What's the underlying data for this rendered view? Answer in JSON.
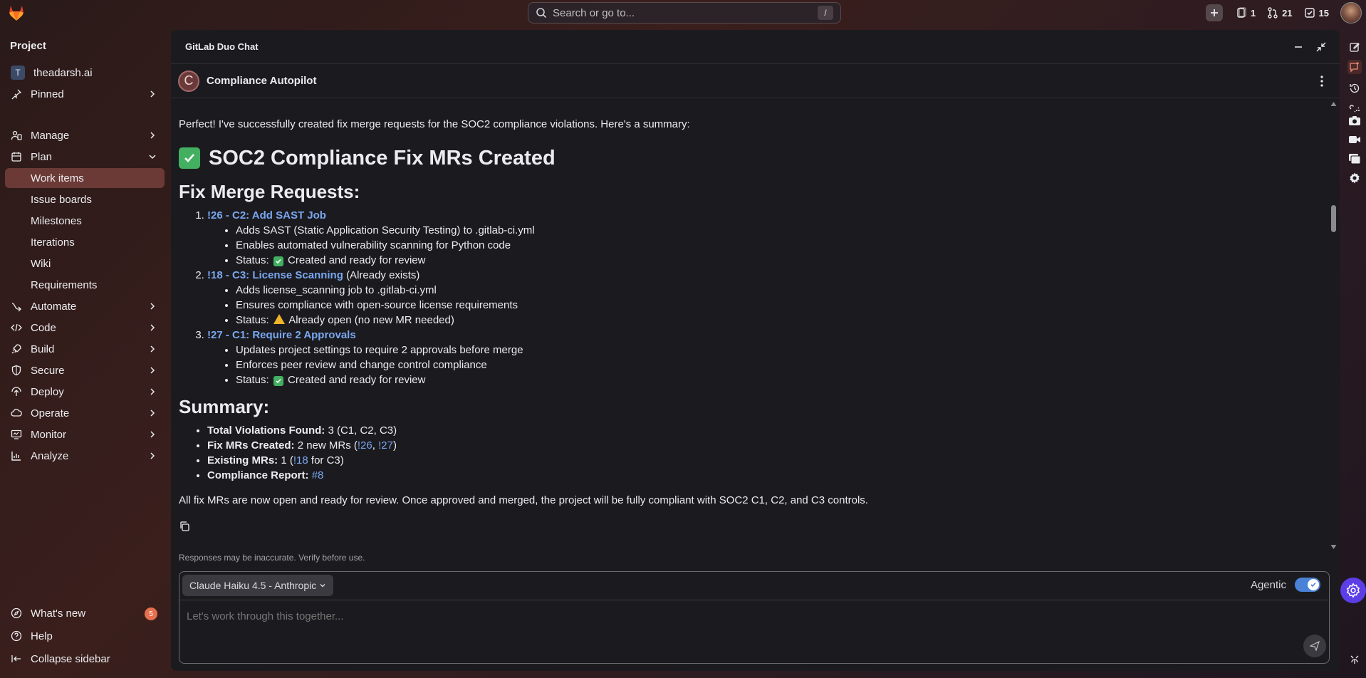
{
  "topbar": {
    "search_placeholder": "Search or go to...",
    "search_shortcut": "/",
    "issues_count": "1",
    "mrs_count": "21",
    "todos_count": "15"
  },
  "sidebar": {
    "title": "Project",
    "project_initial": "T",
    "project_name": "theadarsh.ai",
    "pinned": "Pinned",
    "manage": "Manage",
    "plan": "Plan",
    "plan_items": [
      "Work items",
      "Issue boards",
      "Milestones",
      "Iterations",
      "Wiki",
      "Requirements"
    ],
    "automate": "Automate",
    "code": "Code",
    "build": "Build",
    "secure": "Secure",
    "deploy": "Deploy",
    "operate": "Operate",
    "monitor": "Monitor",
    "analyze": "Analyze",
    "whats_new": "What's new",
    "whats_new_badge": "5",
    "help": "Help",
    "collapse": "Collapse sidebar"
  },
  "chat": {
    "title": "GitLab Duo Chat",
    "agent_initial": "C",
    "agent_name": "Compliance Autopilot",
    "intro": "Perfect! I've successfully created fix merge requests for the SOC2 compliance violations. Here's a summary:",
    "heading": "SOC2 Compliance Fix MRs Created",
    "fix_heading": "Fix Merge Requests:",
    "mrs": [
      {
        "link": "!26 - C2: Add SAST Job",
        "suffix": "",
        "details": [
          "Adds SAST (Static Application Security Testing) to .gitlab-ci.yml",
          "Enables automated vulnerability scanning for Python code"
        ],
        "status_label": "Status:",
        "status_text": "Created and ready for review"
      },
      {
        "link": "!18 - C3: License Scanning",
        "suffix": "(Already exists)",
        "details": [
          "Adds license_scanning job to .gitlab-ci.yml",
          "Ensures compliance with open-source license requirements"
        ],
        "status_label": "Status:",
        "status_text": "Already open (no new MR needed)"
      },
      {
        "link": "!27 - C1: Require 2 Approvals",
        "suffix": "",
        "details": [
          "Updates project settings to require 2 approvals before merge",
          "Enforces peer review and change control compliance"
        ],
        "status_label": "Status:",
        "status_text": "Created and ready for review"
      }
    ],
    "summary_heading": "Summary:",
    "summary": {
      "violations_label": "Total Violations Found:",
      "violations_value": "3 (C1, C2, C3)",
      "fix_label": "Fix MRs Created:",
      "fix_pre": "2 new MRs (",
      "fix_link1": "!26",
      "fix_sep": ", ",
      "fix_link2": "!27",
      "fix_post": ")",
      "existing_label": "Existing MRs:",
      "existing_pre": "1 (",
      "existing_link": "!18",
      "existing_post": "for C3)",
      "report_label": "Compliance Report:",
      "report_link": "#8"
    },
    "closing": "All fix MRs are now open and ready for review. Once approved and merged, the project will be fully compliant with SOC2 C1, C2, and C3 controls.",
    "disclaimer": "Responses may be inaccurate. Verify before use.",
    "model": "Claude Haiku 4.5 - Anthropic",
    "agentic_label": "Agentic",
    "agentic_on": true,
    "input_placeholder": "Let's work through this together..."
  },
  "colors": {
    "accent_link": "#7aa7f0",
    "active_nav": "#6b3a36",
    "success": "#43b061",
    "warning": "#f0b429",
    "toggle": "#4a82d8"
  }
}
